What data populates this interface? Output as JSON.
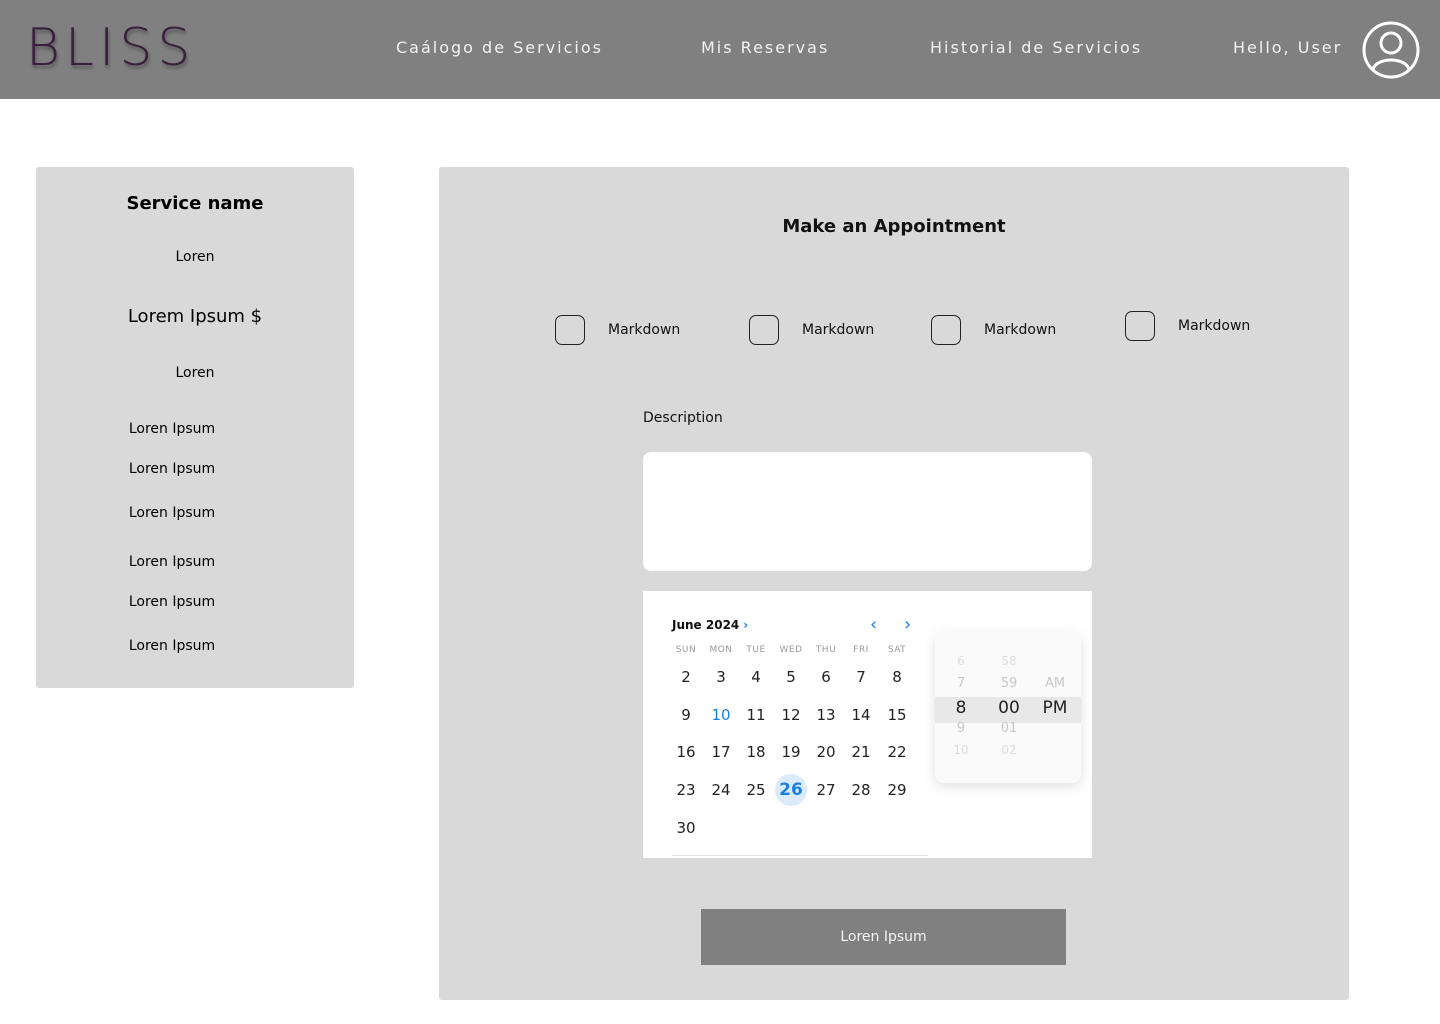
{
  "nav": {
    "logo": "BLISS",
    "links": [
      "Caálogo de Servicios",
      "Mis Reservas",
      "Historial de Servicios"
    ],
    "greeting": "Hello, User"
  },
  "service_card": {
    "title": "Service name",
    "subtitle": "Loren",
    "price": "Lorem Ipsum $",
    "subtitle2": "Loren",
    "items": [
      "Loren Ipsum",
      "Loren Ipsum",
      "Loren Ipsum",
      "Loren Ipsum",
      "Loren Ipsum",
      "Loren Ipsum"
    ]
  },
  "appointment": {
    "title": "Make an Appointment",
    "options": [
      "Markdown",
      "Markdown",
      "Markdown",
      "Markdown"
    ],
    "description_label": "Description",
    "description_value": "",
    "submit_label": "Loren Ipsum"
  },
  "calendar": {
    "month_label": "June 2024",
    "weekdays": [
      "SUN",
      "MON",
      "TUE",
      "WED",
      "THU",
      "FRI",
      "SAT"
    ],
    "weeks": [
      [
        "2",
        "3",
        "4",
        "5",
        "6",
        "7",
        "8"
      ],
      [
        "9",
        "10",
        "11",
        "12",
        "13",
        "14",
        "15"
      ],
      [
        "16",
        "17",
        "18",
        "19",
        "20",
        "21",
        "22"
      ],
      [
        "23",
        "24",
        "25",
        "26",
        "27",
        "28",
        "29"
      ],
      [
        "30"
      ]
    ],
    "today": "10",
    "selected": "26"
  },
  "time_picker": {
    "hours": [
      "6",
      "7",
      "8",
      "9",
      "10"
    ],
    "minutes": [
      "58",
      "59",
      "00",
      "01",
      "02"
    ],
    "periods": [
      "AM",
      "PM"
    ],
    "selected_hour": "8",
    "selected_minute": "00",
    "selected_period": "PM"
  }
}
